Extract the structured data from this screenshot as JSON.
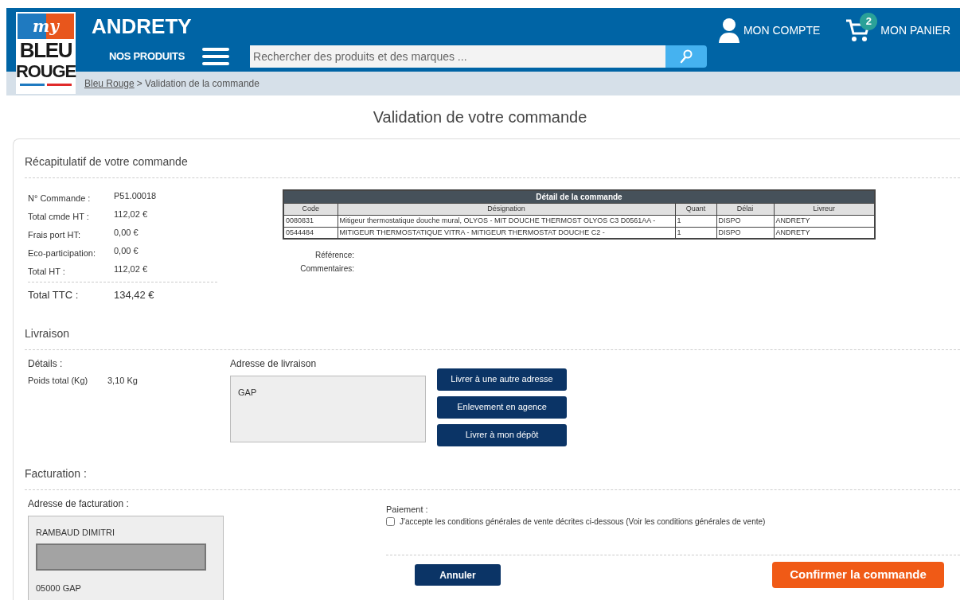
{
  "header": {
    "logo": {
      "top": "my",
      "middle": "BLEU",
      "bottom": "ROUGE"
    },
    "store_name": "ANDRETY",
    "products_menu": "NOS PRODUITS",
    "search": {
      "placeholder": "Rechercher des produits et des marques ..."
    },
    "account": "MON COMPTE",
    "cart": {
      "label": "MON PANIER",
      "count": "2"
    }
  },
  "breadcrumb": {
    "link": "Bleu Rouge",
    "rest": "> Validation de la commande"
  },
  "page_title": "Validation de votre commande",
  "summary": {
    "title": "Récapitulatif de votre commande",
    "rows": [
      {
        "label": "N° Commande :",
        "value": "P51.00018"
      },
      {
        "label": "Total cmde HT :",
        "value": "112,02 €"
      },
      {
        "label": "Frais port HT:",
        "value": "0,00 €"
      },
      {
        "label": "Eco-participation:",
        "value": "0,00 €"
      },
      {
        "label": "Total HT :",
        "value": "112,02 €"
      }
    ],
    "total": {
      "label": "Total TTC :",
      "value": "134,42 €"
    },
    "detail_table": {
      "title": "Détail de la commande",
      "columns": [
        "Code",
        "Désignation",
        "Quant",
        "Délai",
        "Livreur"
      ],
      "rows": [
        [
          "0080831",
          "Mitigeur thermostatique douche mural, OLYOS - MIT DOUCHE THERMOST OLYOS C3 D0561AA -",
          "1",
          "DISPO",
          "ANDRETY"
        ],
        [
          "0544484",
          "MITIGEUR THERMOSTATIQUE VITRA - MITIGEUR THERMOSTAT DOUCHE C2 -",
          "1",
          "DISPO",
          "ANDRETY"
        ]
      ]
    },
    "reference_label": "Référence:",
    "comments_label": "Commentaires:"
  },
  "delivery": {
    "title": "Livraison",
    "details_label": "Détails :",
    "weight_label": "Poids total (Kg)",
    "weight_value": "3,10 Kg",
    "address_label": "Adresse de livraison",
    "address": "GAP",
    "buttons": [
      "Livrer à une autre adresse",
      "Enlevement en agence",
      "Livrer à mon dépôt"
    ]
  },
  "billing": {
    "title": "Facturation :",
    "address_label": "Adresse de facturation :",
    "name": "RAMBAUD DIMITRI",
    "city": "05000 GAP",
    "payment_label": "Paiement :",
    "terms": {
      "label": "J'accepte les conditions générales de vente décrites ci-dessous (Voir les conditions générales de vente)",
      "checked": false
    },
    "cancel": "Annuler",
    "confirm": "Confirmer la commande"
  }
}
